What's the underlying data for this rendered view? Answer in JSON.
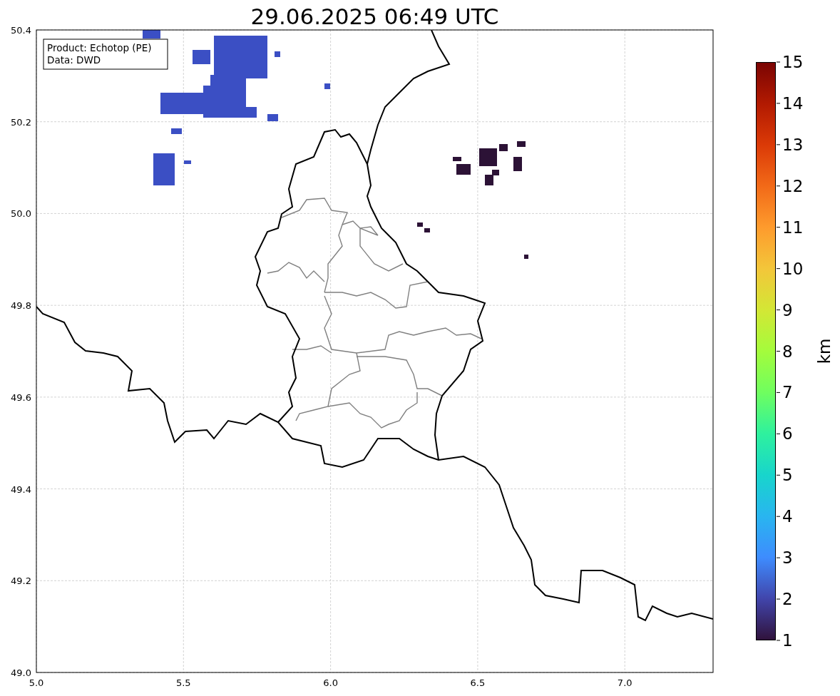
{
  "title": "29.06.2025 06:49 UTC",
  "map": {
    "info": [
      "Product: Echotop (PE)",
      "Data: DWD"
    ],
    "xticks": [
      "5.0",
      "5.5",
      "6.0",
      "6.5",
      "7.0"
    ],
    "yticks": [
      "50.4",
      "50.2",
      "50.0",
      "49.8",
      "49.6",
      "49.4",
      "49.2",
      "49.0"
    ]
  },
  "colorbar": {
    "label": "km",
    "ticks": [
      "15",
      "14",
      "13",
      "12",
      "11",
      "10",
      "9",
      "8",
      "7",
      "6",
      "5",
      "4",
      "3",
      "2",
      "1"
    ]
  }
}
